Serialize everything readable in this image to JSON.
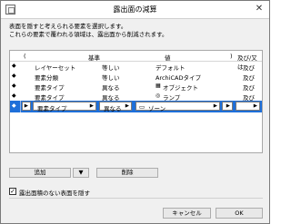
{
  "window": {
    "title": "露出面の減算",
    "close_glyph": "✕"
  },
  "description": {
    "line1": "表面を隠すと考えられる要素を選択します。",
    "line2": "これらの要素で覆われる領域は、露出面から削減されます。"
  },
  "table": {
    "headers": {
      "open_paren": "(",
      "criterion": "基準",
      "value": "値",
      "close_paren": ")",
      "andor": "及び/又は"
    },
    "rows": [
      {
        "arrow": "◆",
        "criterion": "レイヤーセット",
        "op": "等しい",
        "icon": "",
        "value": "デフォルト",
        "andor": "及び"
      },
      {
        "arrow": "◆",
        "criterion": "要素分類",
        "op": "等しい",
        "icon": "",
        "value": "ArchiCADタイプ",
        "andor": "及び"
      },
      {
        "arrow": "◆",
        "criterion": "要素タイプ",
        "op": "異なる",
        "icon": "▦",
        "value": "オブジェクト",
        "andor": "及び"
      },
      {
        "arrow": "◆",
        "criterion": "要素タイプ",
        "op": "異なる",
        "icon": "◎",
        "value": "ランプ",
        "andor": "及び"
      }
    ],
    "selected_row": {
      "arrow": "◆",
      "open_paren": "",
      "criterion": "要素タイプ",
      "op": "異なる",
      "icon": "▭",
      "value": "ゾーン",
      "close_paren": "",
      "andor": ""
    }
  },
  "buttons": {
    "add": "追加",
    "add_arrow": "▼",
    "delete": "削除",
    "cancel": "キャンセル",
    "ok": "OK"
  },
  "checkbox": {
    "label": "露出面積のない表面を隠す",
    "checked": "✓"
  },
  "colors": {
    "selection": "#1e6fd9"
  }
}
